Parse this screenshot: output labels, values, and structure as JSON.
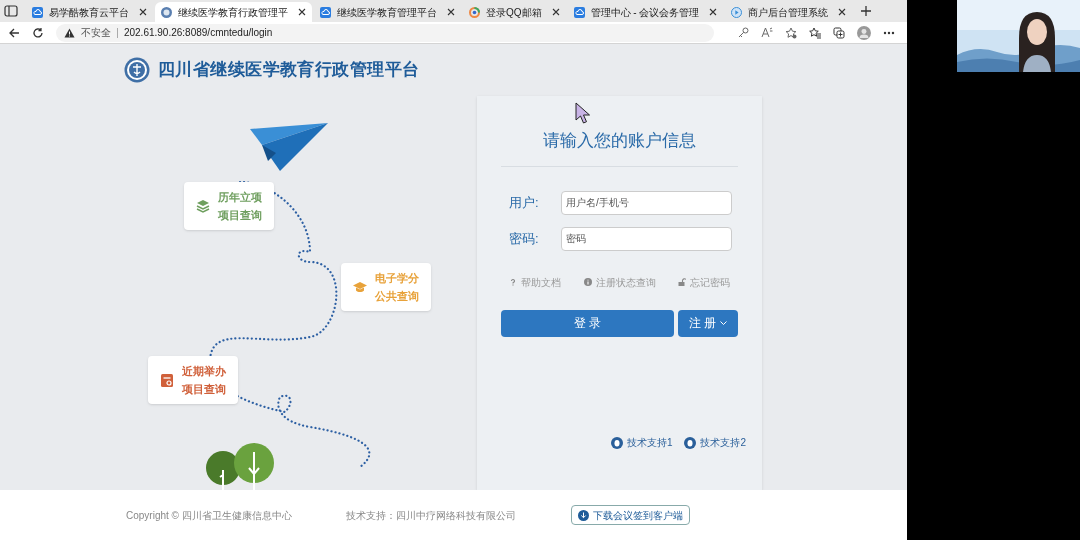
{
  "browser": {
    "tabs": [
      {
        "label": "易学酷教育云平台",
        "selected": false,
        "kind": "cloud"
      },
      {
        "label": "继续医学教育行政管理平",
        "selected": true,
        "kind": "emblem"
      },
      {
        "label": "继续医学教育管理平台",
        "selected": false,
        "kind": "cloud"
      },
      {
        "label": "登录QQ邮箱",
        "selected": false,
        "kind": "ring"
      },
      {
        "label": "管理中心 - 会议会务管理",
        "selected": false,
        "kind": "cloud"
      },
      {
        "label": "商户后台管理系统",
        "selected": false,
        "kind": "play"
      }
    ],
    "address": {
      "security": "不安全",
      "url": "202.61.90.26:8089/cmntedu/login"
    }
  },
  "page": {
    "site_title": "四川省继续医学教育行政管理平台",
    "quick_links": [
      {
        "lines": [
          "历年立项",
          "项目查询"
        ],
        "color": "#6f9f5f",
        "kind": "stack"
      },
      {
        "lines": [
          "电子学分",
          "公共查询"
        ],
        "color": "#e8a23a",
        "kind": "cap"
      },
      {
        "lines": [
          "近期举办",
          "项目查询"
        ],
        "color": "#d0603a",
        "kind": "calendar"
      }
    ],
    "login": {
      "heading": "请输入您的账户信息",
      "fields": [
        {
          "label": "用户:",
          "placeholder": "用户名/手机号"
        },
        {
          "label": "密码:",
          "placeholder": "密码"
        }
      ],
      "links": [
        {
          "label": "帮助文档",
          "kind": "help"
        },
        {
          "label": "注册状态查询",
          "kind": "info"
        },
        {
          "label": "忘记密码",
          "kind": "lock"
        }
      ],
      "login_button": "登 录",
      "register_button": "注 册"
    },
    "support_links": [
      "技术支持1",
      "技术支持2"
    ],
    "footer": {
      "copyright": "Copyright © 四川省卫生健康信息中心",
      "tech_support": "技术支持：四川中疗网络科技有限公司",
      "download_button": "下载会议签到客户端"
    }
  }
}
